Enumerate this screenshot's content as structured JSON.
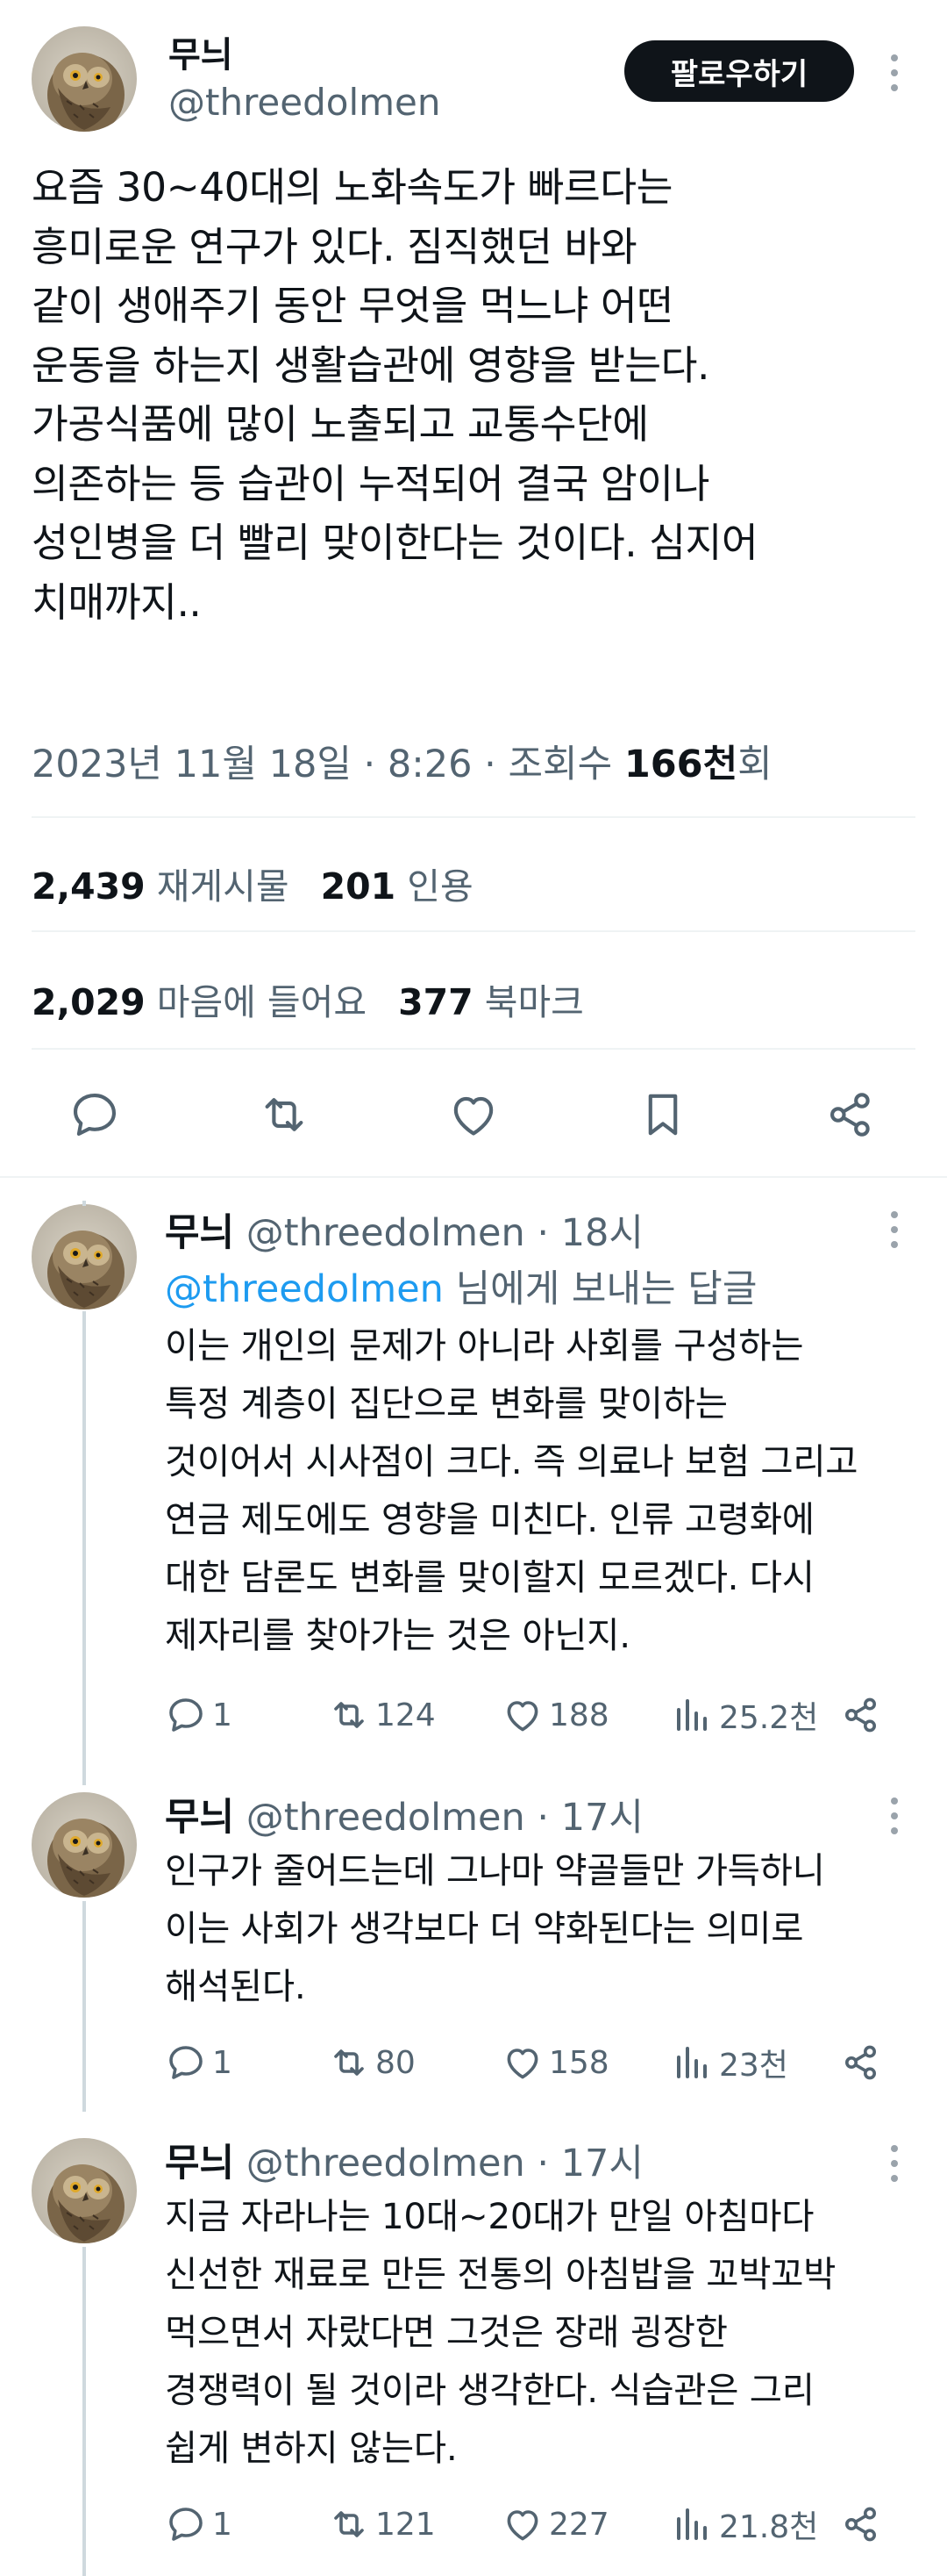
{
  "main_post": {
    "author_name": "무늬",
    "author_handle": "@threedolmen",
    "follow_label": "팔로우하기",
    "text": "요즘 30~40대의 노화속도가 빠르다는\n흥미로운 연구가 있다. 짐직했던 바와\n같이 생애주기 동안 무엇을 먹느냐 어떤\n운동을 하는지 생활습관에 영향을 받는다.\n가공식품에 많이 노출되고 교통수단에\n의존하는 등 습관이 누적되어 결국 암이나\n성인병을 더 빨리 맞이한다는 것이다. 심지어\n치매까지..",
    "timestamp": "2023년 11월 18일 · 8:26 · 조회수 ",
    "views_number": "166천",
    "views_suffix": "회",
    "stats": {
      "reposts_count": "2,439",
      "reposts_label": "재게시물",
      "quotes_count": "201",
      "quotes_label": "인용",
      "likes_count": "2,029",
      "likes_label": "마음에 들어요",
      "bookmarks_count": "377",
      "bookmarks_label": "북마크"
    }
  },
  "replies": [
    {
      "name": "무늬",
      "handle": "@threedolmen · 18시",
      "replying_link": "@threedolmen",
      "replying_suffix": " 님에게 보내는 답글",
      "text": "이는 개인의 문제가 아니라 사회를 구성하는\n특정 계층이 집단으로 변화를 맞이하는\n것이어서 시사점이 크다. 즉 의료나 보험 그리고\n연금 제도에도 영향을 미친다. 인류 고령화에\n대한 담론도 변화를 맞이할지 모르겠다. 다시\n제자리를 찾아가는 것은 아닌지.",
      "replies": "1",
      "reposts": "124",
      "likes": "188",
      "views": "25.2천"
    },
    {
      "name": "무늬",
      "handle": "@threedolmen · 17시",
      "text": "인구가 줄어드는데 그나마 약골들만 가득하니\n이는 사회가 생각보다 더 약화된다는 의미로\n해석된다.",
      "replies": "1",
      "reposts": "80",
      "likes": "158",
      "views": "23천"
    },
    {
      "name": "무늬",
      "handle": "@threedolmen · 17시",
      "text": "지금 자라나는 10대~20대가 만일 아침마다\n신선한 재료로 만든 전통의 아침밥을 꼬박꼬박\n먹으면서 자랐다면 그것은 장래 굉장한\n경쟁력이 될 것이라 생각한다. 식습관은 그리\n쉽게 변하지 않는다.",
      "replies": "1",
      "reposts": "121",
      "likes": "227",
      "views": "21.8천"
    }
  ],
  "icons": {
    "avatar": "owl-avatar",
    "reply": "reply-icon",
    "repost": "repost-icon",
    "like": "heart-icon",
    "bookmark": "bookmark-icon",
    "share": "share-icon",
    "views": "views-chart-icon",
    "more": "more-dots-icon"
  },
  "colors": {
    "link": "#1d9bf0",
    "secondary_text": "#536471",
    "primary_text": "#0f1419",
    "follow_button_bg": "#0f1419"
  }
}
